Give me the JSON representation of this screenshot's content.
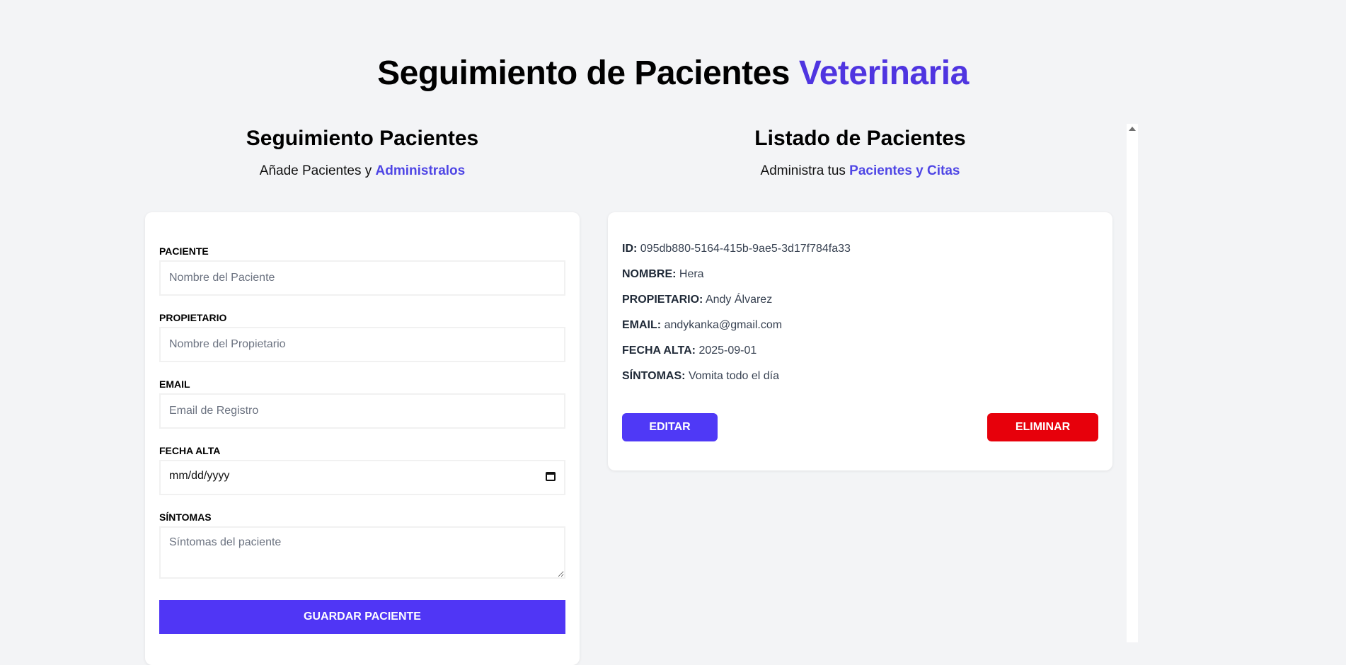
{
  "header": {
    "title_main": "Seguimiento de Pacientes",
    "title_accent": "Veterinaria"
  },
  "form_section": {
    "title": "Seguimiento Pacientes",
    "subtitle": "Añade Pacientes y",
    "subtitle_accent": "Administralos",
    "fields": {
      "patient": {
        "label": "Paciente",
        "placeholder": "Nombre del Paciente"
      },
      "owner": {
        "label": "Propietario",
        "placeholder": "Nombre del Propietario"
      },
      "email": {
        "label": "Email",
        "placeholder": "Email de Registro"
      },
      "date": {
        "label": "Fecha Alta",
        "value_text": "mm/dd/yyyy"
      },
      "symptoms": {
        "label": "Síntomas",
        "placeholder": "Síntomas del paciente"
      }
    },
    "submit_label": "Guardar Paciente"
  },
  "list_section": {
    "title": "Listado de Pacientes",
    "subtitle": "Administra tus",
    "subtitle_accent": "Pacientes y Citas",
    "patient": {
      "id_label": "ID:",
      "id_value": "095db880-5164-415b-9ae5-3d17f784fa33",
      "name_label": "NOMBRE:",
      "name_value": "Hera",
      "owner_label": "PROPIETARIO:",
      "owner_value": "Andy Álvarez",
      "email_label": "EMAIL:",
      "email_value": "andykanka@gmail.com",
      "date_label": "FECHA ALTA:",
      "date_value": "2025-09-01",
      "symptoms_label": "SÍNTOMAS:",
      "symptoms_value": "Vomita todo el día"
    },
    "edit_label": "Editar",
    "delete_label": "Eliminar"
  },
  "colors": {
    "accent": "#4f35e0",
    "primary_button": "#5036f5",
    "danger_button": "#e7000b",
    "background": "#f3f4f6"
  },
  "icons": {
    "calendar": "calendar-icon",
    "scroll_up": "scroll-up-arrow-icon"
  }
}
